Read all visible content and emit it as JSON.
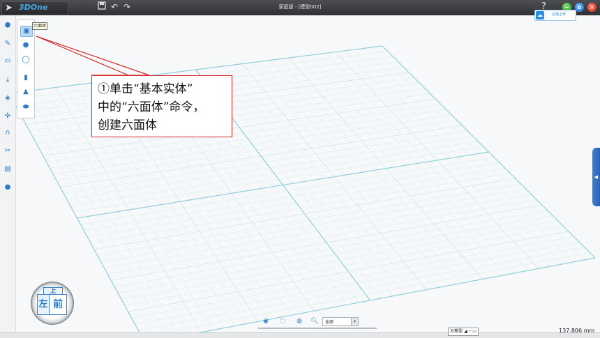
{
  "app": {
    "brand": "3DOne",
    "window_title": "家庭版 - [模型002]",
    "help_label": "?"
  },
  "quick_access": {
    "save_icon": "save-icon",
    "undo_icon": "undo-icon",
    "redo_icon": "redo-icon"
  },
  "window_controls": {
    "minimize": "−",
    "maximize": "o",
    "close": "×"
  },
  "cloud": {
    "label": "云端上传"
  },
  "left_toolbar": [
    "primitive-solid-icon",
    "sketch-icon",
    "edit-sketch-icon",
    "feature-icon",
    "special-feature-icon",
    "assembly-icon",
    "magnet-icon",
    "combine-icon",
    "measure-icon",
    "material-icon"
  ],
  "flyout": {
    "items": [
      "hexahedron-icon",
      "sphere-icon",
      "torus-icon",
      "cylinder-icon",
      "cone-icon",
      "ellipsoid-icon"
    ],
    "tooltip": "六面体"
  },
  "annotation": {
    "line1": "①单击“基本实体”",
    "line2": "中的“六面体”命令，",
    "line3": "创建六面体"
  },
  "view_cube": {
    "top": "上",
    "left": "左",
    "front": "前"
  },
  "bottom_bar": {
    "filter_value": "全部",
    "filter_caret": "▾"
  },
  "status": {
    "mode": "五笔型",
    "mode_icons": [
      "◢",
      "··",
      "▭"
    ],
    "scale": "137.806 mm"
  },
  "right_tab": {
    "arrow": "◀"
  },
  "colors": {
    "grid": "#c9e7ee",
    "grid_major": "#8fcfdc",
    "callout_border": "#d42a2a",
    "accent": "#2f7bc8"
  }
}
